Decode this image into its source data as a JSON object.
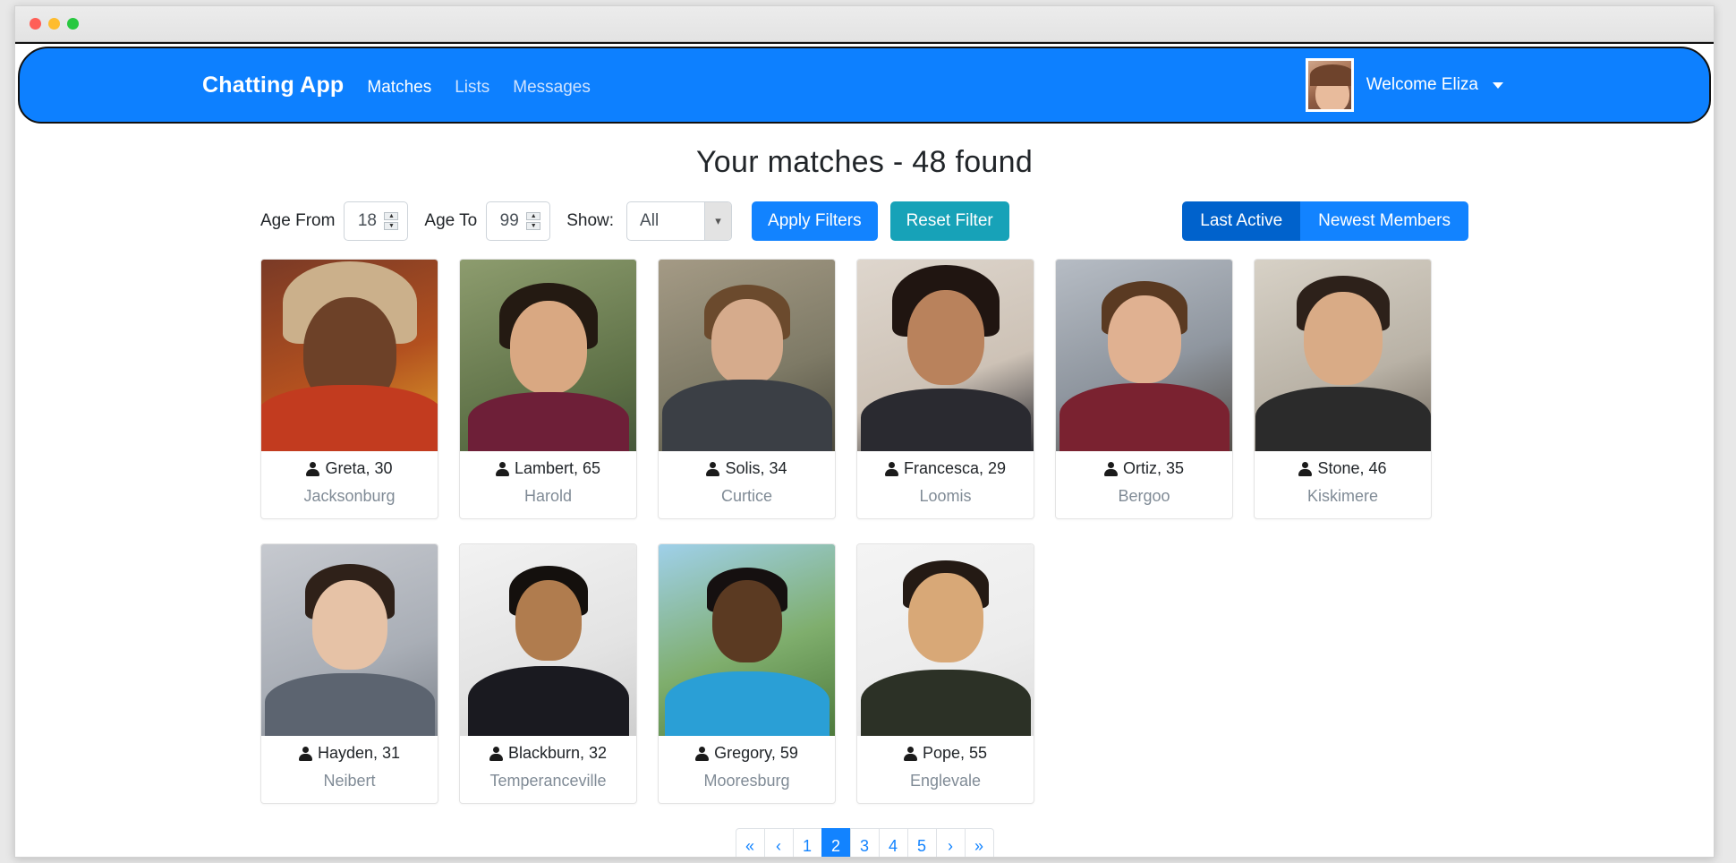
{
  "window": {
    "traffic_lights": [
      "close",
      "minimize",
      "zoom"
    ]
  },
  "navbar": {
    "brand": "Chatting App",
    "links": [
      {
        "label": "Matches",
        "state": "active"
      },
      {
        "label": "Lists",
        "state": "muted"
      },
      {
        "label": "Messages",
        "state": "muted"
      }
    ],
    "user": {
      "welcome": "Welcome Eliza",
      "avatar_alt": "Eliza avatar",
      "caret": "chevron-down"
    },
    "bg_color": "#0d80ff"
  },
  "page": {
    "title": "Your matches - 48 found",
    "match_count": 48
  },
  "filters": {
    "age_from_label": "Age From",
    "age_from_value": "18",
    "age_to_label": "Age To",
    "age_to_value": "99",
    "show_label": "Show:",
    "show_value": "All",
    "show_options": [
      "All"
    ],
    "apply_label": "Apply Filters",
    "reset_label": "Reset Filter",
    "apply_color": "#1283ff",
    "reset_color": "#17a2b8"
  },
  "sort": {
    "options": [
      {
        "label": "Last Active",
        "active": true
      },
      {
        "label": "Newest Members",
        "active": false
      }
    ],
    "active_color": "#0062cc",
    "inactive_color": "#1283ff"
  },
  "cards": [
    [
      {
        "name": "Greta",
        "age": 30,
        "city": "Jacksonburg",
        "name_line": "Greta, 30",
        "photo": {
          "bg": "#8a3b2a",
          "skin": "#6d4128",
          "hair": "#c9b08a",
          "body": "#c23b1f"
        }
      },
      {
        "name": "Lambert",
        "age": 65,
        "city": "Harold",
        "name_line": "Lambert, 65",
        "photo": {
          "bg": "#6c7f55",
          "skin": "#d9a882",
          "hair": "#231a14",
          "body": "#6e1f38"
        }
      },
      {
        "name": "Solis",
        "age": 34,
        "city": "Curtice",
        "name_line": "Solis, 34",
        "photo": {
          "bg": "#8a8a7a",
          "skin": "#d6ab8c",
          "hair": "#6b4a2d",
          "body": "#3b3f45"
        }
      },
      {
        "name": "Francesca",
        "age": 29,
        "city": "Loomis",
        "name_line": "Francesca, 29",
        "photo": {
          "bg": "#d8cfc6",
          "skin": "#b9825c",
          "hair": "#201511",
          "body": "#2a2a30"
        }
      },
      {
        "name": "Ortiz",
        "age": 35,
        "city": "Bergoo",
        "name_line": "Ortiz, 35",
        "photo": {
          "bg": "#9aa3ad",
          "skin": "#e0b191",
          "hair": "#5a3a22",
          "body": "#7a2230"
        }
      },
      {
        "name": "Stone",
        "age": 46,
        "city": "Kiskimere",
        "name_line": "Stone, 46",
        "photo": {
          "bg": "#cfc8bd",
          "skin": "#d9ab86",
          "hair": "#2d211a",
          "body": "#2b2b2b"
        }
      }
    ],
    [
      {
        "name": "Hayden",
        "age": 31,
        "city": "Neibert",
        "name_line": "Hayden, 31",
        "photo": {
          "bg": "#b9bcc2",
          "skin": "#e6c2a6",
          "hair": "#2f2119",
          "body": "#5c6470"
        }
      },
      {
        "name": "Blackburn",
        "age": 32,
        "city": "Temperanceville",
        "name_line": "Blackburn, 32",
        "photo": {
          "bg": "#e9e9e9",
          "skin": "#b07c4e",
          "hair": "#14100d",
          "body": "#1a1a20"
        }
      },
      {
        "name": "Gregory",
        "age": 59,
        "city": "Mooresburg",
        "name_line": "Gregory, 59",
        "photo": {
          "bg": "#78a86b",
          "skin": "#5b3a22",
          "hair": "#151010",
          "body": "#2a9fd6"
        }
      },
      {
        "name": "Pope",
        "age": 55,
        "city": "Englevale",
        "name_line": "Pope, 55",
        "photo": {
          "bg": "#efefef",
          "skin": "#d8a877",
          "hair": "#241a14",
          "body": "#2c3126"
        }
      }
    ]
  ],
  "pagination": {
    "items": [
      {
        "label": "«",
        "name": "first",
        "active": false
      },
      {
        "label": "‹",
        "name": "previous",
        "active": false
      },
      {
        "label": "1",
        "name": "page-1",
        "active": false
      },
      {
        "label": "2",
        "name": "page-2",
        "active": true
      },
      {
        "label": "3",
        "name": "page-3",
        "active": false
      },
      {
        "label": "4",
        "name": "page-4",
        "active": false
      },
      {
        "label": "5",
        "name": "page-5",
        "active": false
      },
      {
        "label": "›",
        "name": "next",
        "active": false
      },
      {
        "label": "»",
        "name": "last",
        "active": false
      }
    ],
    "current_page": 2,
    "active_color": "#1283ff"
  }
}
